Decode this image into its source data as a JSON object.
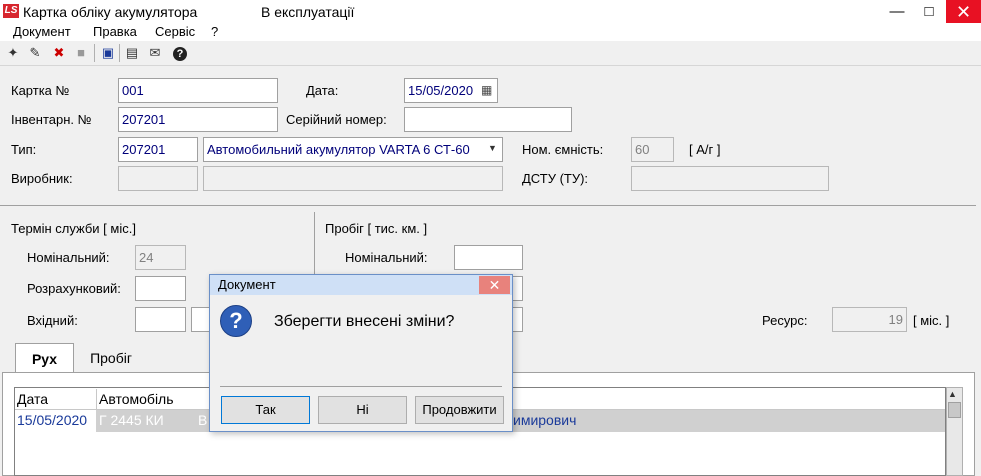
{
  "window": {
    "app_badge": "LS",
    "title": "Картка обліку акумулятора",
    "status": "В експлуатації"
  },
  "menu": [
    "Документ",
    "Правка",
    "Сервіс",
    "?"
  ],
  "form": {
    "card_no_label": "Картка №",
    "card_no_value": "001",
    "date_label": "Дата:",
    "date_value": "15/05/2020",
    "inventory_label": "Інвентарн. №",
    "inventory_value": "207201",
    "serial_label": "Серійний номер:",
    "serial_value": "",
    "type_label": "Тип:",
    "type_code": "207201",
    "type_name": "Автомобильний акумулятор VARTA 6 СТ-60",
    "capacity_label": "Ном. ємність:",
    "capacity_value": "60",
    "capacity_unit": "[ А/г ]",
    "maker_label": "Виробник:",
    "dstu_label": "ДСТУ (ТУ):"
  },
  "service": {
    "title": "Термін служби [ міс.]",
    "nominal_label": "Номінальний:",
    "nominal_value": "24",
    "calculated_label": "Розрахунковий:",
    "input_label": "Вхідний:"
  },
  "mileage": {
    "title": "Пробіг [ тис. км. ]",
    "nominal_label": "Номінальний:"
  },
  "resource": {
    "label": "Ресурс:",
    "value": "19",
    "unit": "[ міс. ]"
  },
  "tabs": [
    "Рух",
    "Пробіг"
  ],
  "grid": {
    "columns": [
      "Дата",
      "Автомобіль"
    ],
    "row": {
      "date": "15/05/2020",
      "car": "Г 2445 КИ",
      "col3": "В",
      "tail": "имирович"
    }
  },
  "dialog": {
    "title": "Документ",
    "message": "Зберегти внесені зміни?",
    "buttons": [
      "Так",
      "Ні",
      "Продовжити"
    ]
  }
}
